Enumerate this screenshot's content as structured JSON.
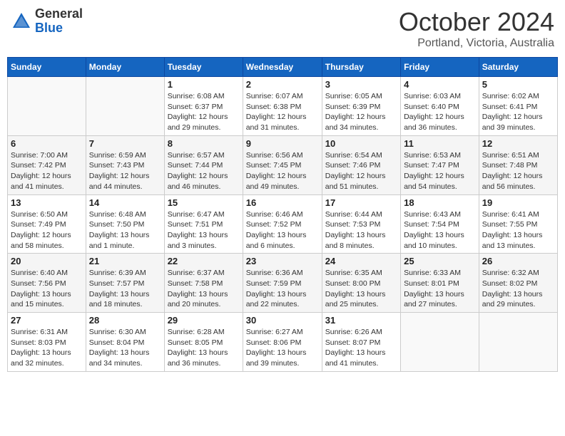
{
  "header": {
    "logo_general": "General",
    "logo_blue": "Blue",
    "month_title": "October 2024",
    "subtitle": "Portland, Victoria, Australia"
  },
  "calendar": {
    "days_of_week": [
      "Sunday",
      "Monday",
      "Tuesday",
      "Wednesday",
      "Thursday",
      "Friday",
      "Saturday"
    ],
    "weeks": [
      [
        {
          "day": "",
          "info": ""
        },
        {
          "day": "",
          "info": ""
        },
        {
          "day": "1",
          "info": "Sunrise: 6:08 AM\nSunset: 6:37 PM\nDaylight: 12 hours and 29 minutes."
        },
        {
          "day": "2",
          "info": "Sunrise: 6:07 AM\nSunset: 6:38 PM\nDaylight: 12 hours and 31 minutes."
        },
        {
          "day": "3",
          "info": "Sunrise: 6:05 AM\nSunset: 6:39 PM\nDaylight: 12 hours and 34 minutes."
        },
        {
          "day": "4",
          "info": "Sunrise: 6:03 AM\nSunset: 6:40 PM\nDaylight: 12 hours and 36 minutes."
        },
        {
          "day": "5",
          "info": "Sunrise: 6:02 AM\nSunset: 6:41 PM\nDaylight: 12 hours and 39 minutes."
        }
      ],
      [
        {
          "day": "6",
          "info": "Sunrise: 7:00 AM\nSunset: 7:42 PM\nDaylight: 12 hours and 41 minutes."
        },
        {
          "day": "7",
          "info": "Sunrise: 6:59 AM\nSunset: 7:43 PM\nDaylight: 12 hours and 44 minutes."
        },
        {
          "day": "8",
          "info": "Sunrise: 6:57 AM\nSunset: 7:44 PM\nDaylight: 12 hours and 46 minutes."
        },
        {
          "day": "9",
          "info": "Sunrise: 6:56 AM\nSunset: 7:45 PM\nDaylight: 12 hours and 49 minutes."
        },
        {
          "day": "10",
          "info": "Sunrise: 6:54 AM\nSunset: 7:46 PM\nDaylight: 12 hours and 51 minutes."
        },
        {
          "day": "11",
          "info": "Sunrise: 6:53 AM\nSunset: 7:47 PM\nDaylight: 12 hours and 54 minutes."
        },
        {
          "day": "12",
          "info": "Sunrise: 6:51 AM\nSunset: 7:48 PM\nDaylight: 12 hours and 56 minutes."
        }
      ],
      [
        {
          "day": "13",
          "info": "Sunrise: 6:50 AM\nSunset: 7:49 PM\nDaylight: 12 hours and 58 minutes."
        },
        {
          "day": "14",
          "info": "Sunrise: 6:48 AM\nSunset: 7:50 PM\nDaylight: 13 hours and 1 minute."
        },
        {
          "day": "15",
          "info": "Sunrise: 6:47 AM\nSunset: 7:51 PM\nDaylight: 13 hours and 3 minutes."
        },
        {
          "day": "16",
          "info": "Sunrise: 6:46 AM\nSunset: 7:52 PM\nDaylight: 13 hours and 6 minutes."
        },
        {
          "day": "17",
          "info": "Sunrise: 6:44 AM\nSunset: 7:53 PM\nDaylight: 13 hours and 8 minutes."
        },
        {
          "day": "18",
          "info": "Sunrise: 6:43 AM\nSunset: 7:54 PM\nDaylight: 13 hours and 10 minutes."
        },
        {
          "day": "19",
          "info": "Sunrise: 6:41 AM\nSunset: 7:55 PM\nDaylight: 13 hours and 13 minutes."
        }
      ],
      [
        {
          "day": "20",
          "info": "Sunrise: 6:40 AM\nSunset: 7:56 PM\nDaylight: 13 hours and 15 minutes."
        },
        {
          "day": "21",
          "info": "Sunrise: 6:39 AM\nSunset: 7:57 PM\nDaylight: 13 hours and 18 minutes."
        },
        {
          "day": "22",
          "info": "Sunrise: 6:37 AM\nSunset: 7:58 PM\nDaylight: 13 hours and 20 minutes."
        },
        {
          "day": "23",
          "info": "Sunrise: 6:36 AM\nSunset: 7:59 PM\nDaylight: 13 hours and 22 minutes."
        },
        {
          "day": "24",
          "info": "Sunrise: 6:35 AM\nSunset: 8:00 PM\nDaylight: 13 hours and 25 minutes."
        },
        {
          "day": "25",
          "info": "Sunrise: 6:33 AM\nSunset: 8:01 PM\nDaylight: 13 hours and 27 minutes."
        },
        {
          "day": "26",
          "info": "Sunrise: 6:32 AM\nSunset: 8:02 PM\nDaylight: 13 hours and 29 minutes."
        }
      ],
      [
        {
          "day": "27",
          "info": "Sunrise: 6:31 AM\nSunset: 8:03 PM\nDaylight: 13 hours and 32 minutes."
        },
        {
          "day": "28",
          "info": "Sunrise: 6:30 AM\nSunset: 8:04 PM\nDaylight: 13 hours and 34 minutes."
        },
        {
          "day": "29",
          "info": "Sunrise: 6:28 AM\nSunset: 8:05 PM\nDaylight: 13 hours and 36 minutes."
        },
        {
          "day": "30",
          "info": "Sunrise: 6:27 AM\nSunset: 8:06 PM\nDaylight: 13 hours and 39 minutes."
        },
        {
          "day": "31",
          "info": "Sunrise: 6:26 AM\nSunset: 8:07 PM\nDaylight: 13 hours and 41 minutes."
        },
        {
          "day": "",
          "info": ""
        },
        {
          "day": "",
          "info": ""
        }
      ]
    ]
  }
}
